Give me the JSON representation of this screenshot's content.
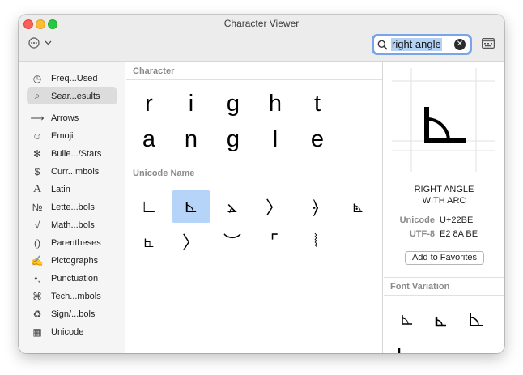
{
  "window": {
    "title": "Character Viewer"
  },
  "search": {
    "value": "right angle",
    "clear": "✕"
  },
  "sidebar": {
    "items": [
      {
        "label": "Freq...Used",
        "icon": "clock-icon",
        "glyph": "◷"
      },
      {
        "label": "Sear...esults",
        "icon": "search-icon",
        "glyph": "⌕",
        "selected": true
      },
      {
        "label": "Arrows",
        "icon": "arrow-icon",
        "glyph": "⟶"
      },
      {
        "label": "Emoji",
        "icon": "smiley-icon",
        "glyph": "☺"
      },
      {
        "label": "Bulle.../Stars",
        "icon": "asterisk-icon",
        "glyph": "✻"
      },
      {
        "label": "Curr...mbols",
        "icon": "dollar-icon",
        "glyph": "$"
      },
      {
        "label": "Latin",
        "icon": "latin-letter-icon",
        "glyph": "A"
      },
      {
        "label": "Lette...bols",
        "icon": "numero-icon",
        "glyph": "№"
      },
      {
        "label": "Math...bols",
        "icon": "sqrt-icon",
        "glyph": "√"
      },
      {
        "label": "Parentheses",
        "icon": "parentheses-icon",
        "glyph": "()"
      },
      {
        "label": "Pictographs",
        "icon": "pencil-icon",
        "glyph": "✍"
      },
      {
        "label": "Punctuation",
        "icon": "punctuation-icon",
        "glyph": "•,"
      },
      {
        "label": "Tech...mbols",
        "icon": "command-icon",
        "glyph": "⌘"
      },
      {
        "label": "Sign/...bols",
        "icon": "recycle-icon",
        "glyph": "♻"
      },
      {
        "label": "Unicode",
        "icon": "unicode-grid-icon",
        "glyph": "▦"
      }
    ]
  },
  "character_section": {
    "heading": "Character",
    "row1": [
      "r",
      "i",
      "g",
      "h",
      "t"
    ],
    "row2": [
      "a",
      "n",
      "g",
      "l",
      "e"
    ]
  },
  "unicode_section": {
    "heading": "Unicode Name",
    "glyphs": [
      "∟",
      "⊾",
      "⦛",
      "〉",
      "⦒",
      "⦝",
      "⦜",
      "〉",
      "︶",
      "⌜",
      "⦚"
    ]
  },
  "detail": {
    "preview": "⊾",
    "name_line1": "RIGHT ANGLE",
    "name_line2": "WITH ARC",
    "unicode_label": "Unicode",
    "unicode_value": "U+22BE",
    "utf8_label": "UTF-8",
    "utf8_value": "E2 8A BE",
    "favorites_button": "Add to Favorites",
    "font_variation_heading": "Font Variation"
  }
}
